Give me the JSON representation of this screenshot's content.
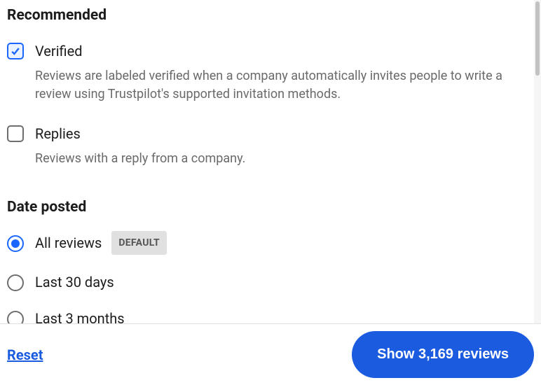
{
  "recommended": {
    "heading": "Recommended",
    "verified": {
      "label": "Verified",
      "desc": "Reviews are labeled verified when a company automatically invites people to write a review using Trustpilot's supported invitation methods.",
      "checked": true
    },
    "replies": {
      "label": "Replies",
      "desc": "Reviews with a reply from a company.",
      "checked": false
    }
  },
  "date_posted": {
    "heading": "Date posted",
    "default_badge": "DEFAULT",
    "options": {
      "all": "All reviews",
      "last30": "Last 30 days",
      "last3m": "Last 3 months"
    },
    "selected": "all"
  },
  "footer": {
    "reset": "Reset",
    "show_button": "Show 3,169 reviews"
  }
}
